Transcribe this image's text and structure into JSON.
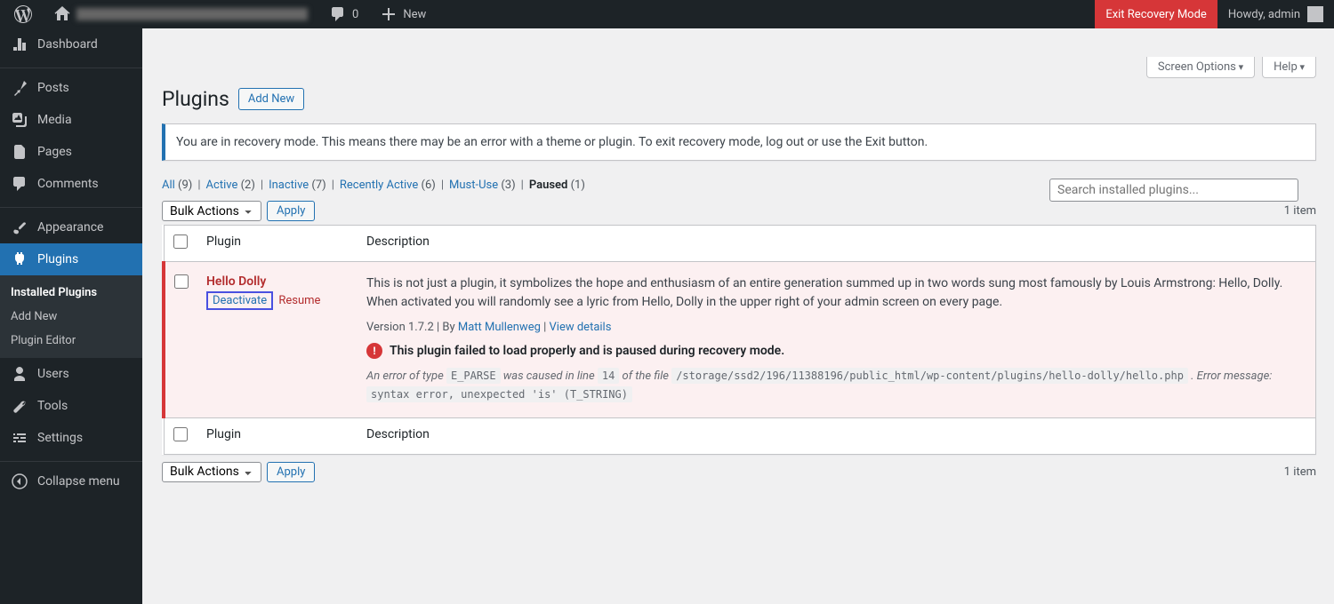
{
  "topbar": {
    "comments": "0",
    "new": "New",
    "exit_recovery": "Exit Recovery Mode",
    "howdy": "Howdy, admin"
  },
  "sidebar": {
    "dashboard": "Dashboard",
    "posts": "Posts",
    "media": "Media",
    "pages": "Pages",
    "comments": "Comments",
    "appearance": "Appearance",
    "plugins": "Plugins",
    "submenu": {
      "installed": "Installed Plugins",
      "add_new": "Add New",
      "editor": "Plugin Editor"
    },
    "users": "Users",
    "tools": "Tools",
    "settings": "Settings",
    "collapse": "Collapse menu"
  },
  "screen_meta": {
    "options": "Screen Options",
    "help": "Help"
  },
  "header": {
    "title": "Plugins",
    "add_new": "Add New"
  },
  "notice": "You are in recovery mode. This means there may be an error with a theme or plugin. To exit recovery mode, log out or use the Exit button.",
  "filters": {
    "all": {
      "label": "All",
      "count": "(9)"
    },
    "active": {
      "label": "Active",
      "count": "(2)"
    },
    "inactive": {
      "label": "Inactive",
      "count": "(7)"
    },
    "recently": {
      "label": "Recently Active",
      "count": "(6)"
    },
    "mustuse": {
      "label": "Must-Use",
      "count": "(3)"
    },
    "paused": {
      "label": "Paused",
      "count": "(1)"
    }
  },
  "search_placeholder": "Search installed plugins...",
  "bulk": {
    "label": "Bulk Actions",
    "apply": "Apply"
  },
  "item_count": "1 item",
  "table": {
    "plugin_header": "Plugin",
    "desc_header": "Description"
  },
  "plugin": {
    "name": "Hello Dolly",
    "deactivate": "Deactivate",
    "resume": "Resume",
    "description": "This is not just a plugin, it symbolizes the hope and enthusiasm of an entire generation summed up in two words sung most famously by Louis Armstrong: Hello, Dolly. When activated you will randomly see a lyric from Hello, Dolly in the upper right of your admin screen on every page.",
    "version_prefix": "Version 1.7.2 | By ",
    "author": "Matt Mullenweg",
    "sep": " | ",
    "view_details": "View details",
    "error_notice": "This plugin failed to load properly and is paused during recovery mode.",
    "error": {
      "p1": "An error of type ",
      "c1": "E_PARSE",
      "p2": " was caused in line ",
      "c2": "14",
      "p3": " of the file ",
      "c3": "/storage/ssd2/196/11388196/public_html/wp-content/plugins/hello-dolly/hello.php",
      "p4": " . Error message: ",
      "c4": "syntax error, unexpected 'is' (T_STRING)"
    }
  }
}
